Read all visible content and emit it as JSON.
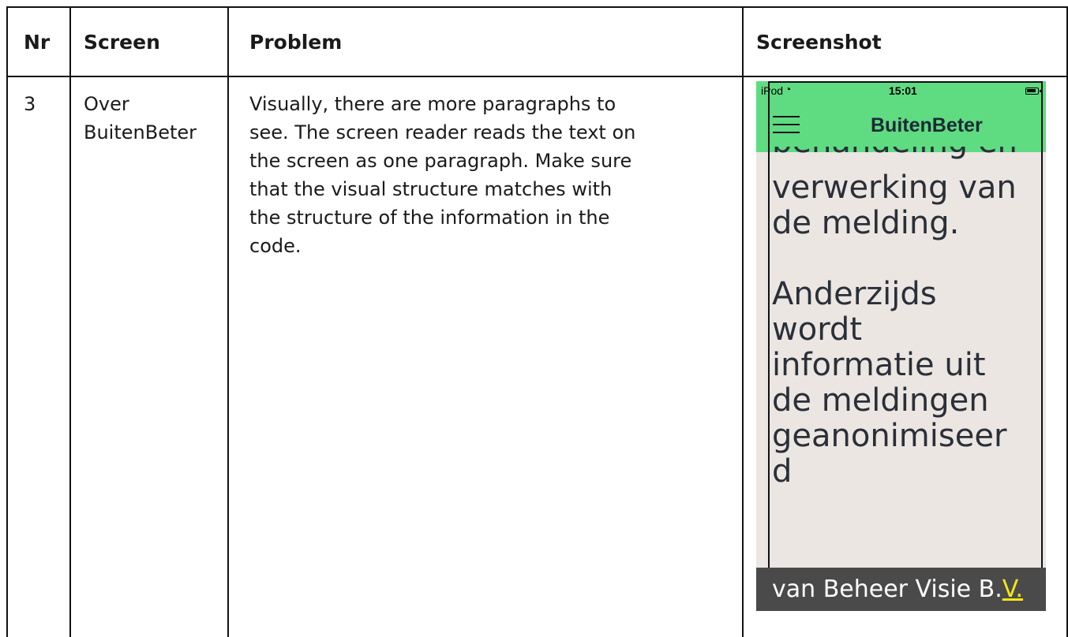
{
  "table": {
    "headers": [
      "Nr",
      "Screen",
      "Problem",
      "Screenshot"
    ],
    "rows": [
      {
        "nr": "3",
        "screen_line1": "Over",
        "screen_line2": "BuitenBeter",
        "problem_lines": [
          "Visually, there are more paragraphs to",
          "see. The screen reader reads the text on",
          "the screen as one paragraph. Make sure",
          "that the visual structure matches with",
          "the structure of the information in the",
          "code."
        ]
      }
    ]
  },
  "phone": {
    "statusbar": {
      "carrier": "iPod",
      "time": "15:01"
    },
    "app_title": "BuitenBeter",
    "cut_line": "behandeling en",
    "paragraph1": [
      "verwerking van",
      "de melding."
    ],
    "paragraph2": [
      "Anderzijds",
      "wordt",
      "informatie uit",
      "de meldingen",
      "geanonimiseer",
      "d"
    ],
    "caption_prefix": "van Beheer Visie B.",
    "caption_highlight": "V.",
    "colors": {
      "navbar": "#5fdb82",
      "background": "#ebe6e2",
      "caption_bg": "#4a4a4a",
      "caption_highlight": "#f5e614"
    }
  }
}
